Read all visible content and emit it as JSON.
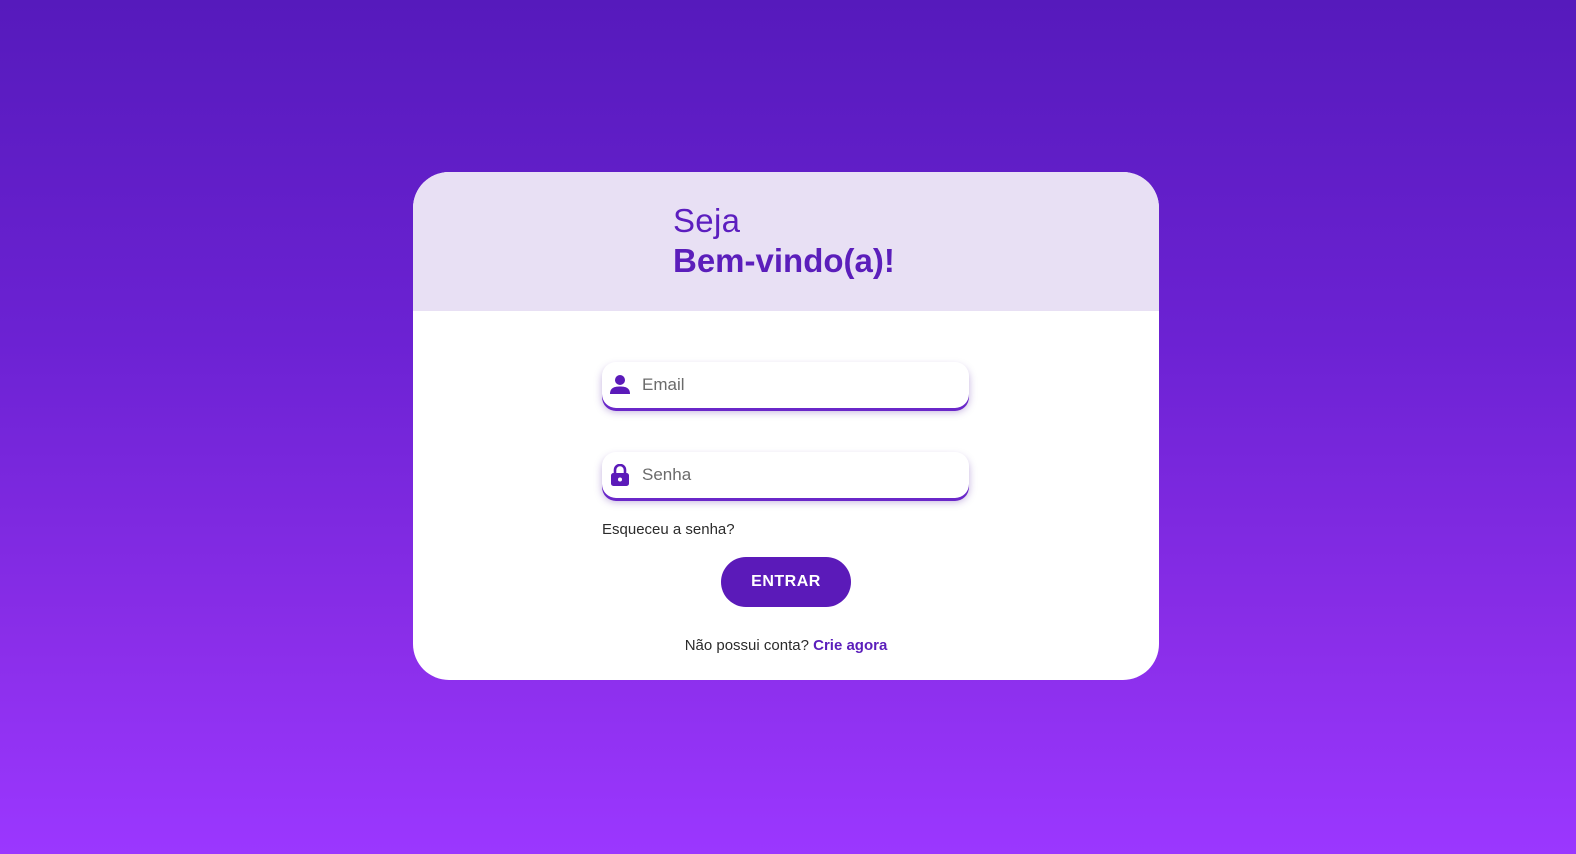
{
  "header": {
    "greeting_small": "Seja",
    "greeting_big": "Bem-vindo(a)!"
  },
  "form": {
    "email": {
      "placeholder": "Email",
      "value": "",
      "icon": "user-icon"
    },
    "password": {
      "placeholder": "Senha",
      "value": "",
      "icon": "lock-icon"
    },
    "forgot_label": "Esqueceu a senha?",
    "submit_label": "ENTRAR"
  },
  "signup": {
    "prompt": "Não possui conta?",
    "link_label": "Crie agora"
  },
  "colors": {
    "accent": "#5b1ebb",
    "header_bg": "#e8e0f4",
    "background_top": "#561abc",
    "background_bottom": "#9b37ff"
  }
}
